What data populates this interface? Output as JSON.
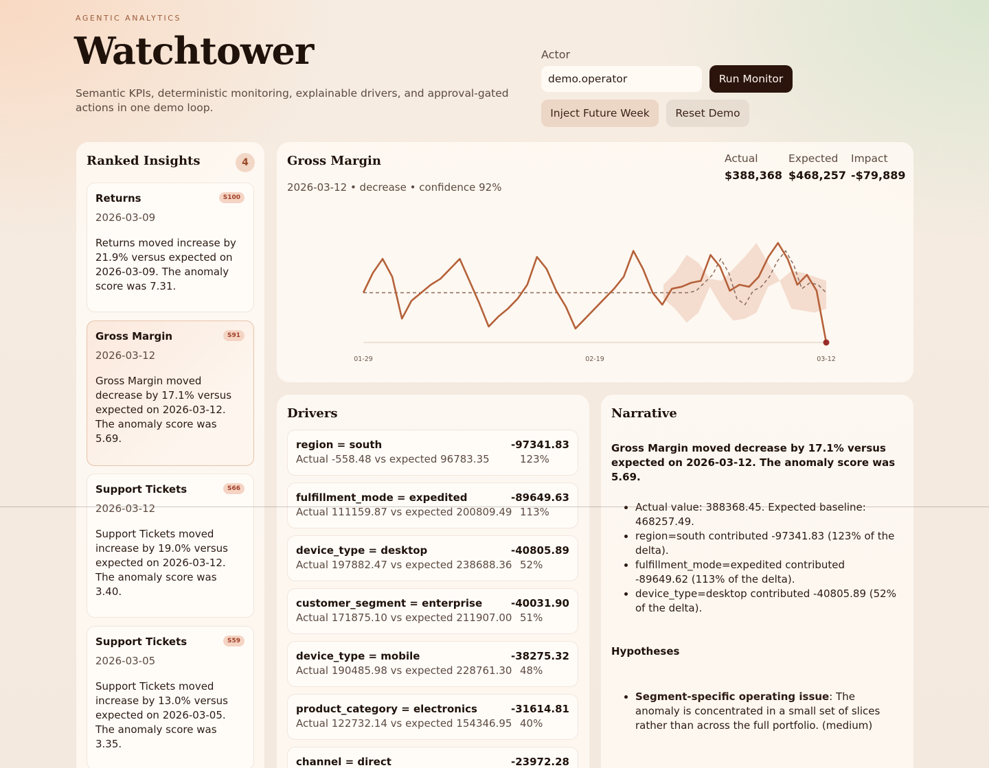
{
  "header": {
    "eyebrow": "AGENTIC ANALYTICS",
    "title": "Watchtower",
    "subtitle": "Semantic KPIs, deterministic monitoring, explainable drivers, and approval-gated actions in one demo loop."
  },
  "controls": {
    "actor_label": "Actor",
    "actor_value": "demo.operator",
    "run_label": "Run Monitor",
    "inject_label": "Inject Future Week",
    "reset_label": "Reset Demo"
  },
  "insights": {
    "title": "Ranked Insights",
    "count": "4",
    "items": [
      {
        "metric": "Returns",
        "score": "S100",
        "date": "2026-03-09",
        "text": "Returns moved increase by 21.9% versus expected on 2026-03-09. The anomaly score was 7.31."
      },
      {
        "metric": "Gross Margin",
        "score": "S91",
        "date": "2026-03-12",
        "text": "Gross Margin moved decrease by 17.1% versus expected on 2026-03-12. The anomaly score was 5.69."
      },
      {
        "metric": "Support Tickets",
        "score": "S66",
        "date": "2026-03-12",
        "text": "Support Tickets moved increase by 19.0% versus expected on 2026-03-12. The anomaly score was 3.40."
      },
      {
        "metric": "Support Tickets",
        "score": "S59",
        "date": "2026-03-05",
        "text": "Support Tickets moved increase by 13.0% versus expected on 2026-03-05. The anomaly score was 3.35."
      }
    ]
  },
  "detail": {
    "title": "Gross Margin",
    "subtitle": "2026-03-12 • decrease • confidence 92%",
    "actual_label": "Actual",
    "actual_value": "$388,368",
    "expected_label": "Expected",
    "expected_value": "$468,257",
    "impact_label": "Impact",
    "impact_value": "-$79,889"
  },
  "chart_data": {
    "type": "line",
    "x_tick_labels": [
      "01-29",
      "02-19",
      "03-12"
    ],
    "series": [
      {
        "values": [
          0.5,
          0.7,
          0.84,
          0.66,
          0.24,
          0.42,
          0.5,
          0.58,
          0.64,
          0.74,
          0.84,
          0.62,
          0.4,
          0.16,
          0.26,
          0.34,
          0.44,
          0.58,
          0.86,
          0.74,
          0.52,
          0.36,
          0.14,
          0.24,
          0.34,
          0.44,
          0.54,
          0.66,
          0.92,
          0.74,
          0.5,
          0.38,
          0.54,
          0.56,
          0.6,
          0.62,
          0.88,
          0.76,
          0.52,
          0.58,
          0.56,
          0.66,
          0.86,
          1.0,
          0.84,
          0.58,
          0.68,
          0.52,
          0.0
        ]
      },
      {
        "values": [
          0.5,
          0.5,
          0.5,
          0.5,
          0.5,
          0.5,
          0.5,
          0.5,
          0.5,
          0.5,
          0.5,
          0.5,
          0.5,
          0.5,
          0.5,
          0.5,
          0.5,
          0.5,
          0.5,
          0.5,
          0.5,
          0.5,
          0.5,
          0.5,
          0.5,
          0.5,
          0.5,
          0.5,
          0.5,
          0.5,
          0.5,
          0.5,
          0.5,
          0.5,
          0.5,
          0.5,
          0.5,
          0.5,
          0.5,
          0.5,
          0.5,
          0.52,
          0.6,
          0.68,
          0.84,
          0.7,
          0.44,
          0.38,
          0.52,
          0.56,
          0.66,
          0.82,
          0.92,
          0.78,
          0.54,
          0.6,
          0.58,
          0.5
        ]
      }
    ],
    "band_lower": [
      0.44,
      0.34,
      0.2,
      0.3,
      0.56,
      0.36,
      0.22,
      0.24,
      0.3,
      0.56,
      0.62,
      0.34,
      0.32,
      0.3,
      0.34
    ],
    "band_upper": [
      0.58,
      0.7,
      0.88,
      0.8,
      0.64,
      0.62,
      0.74,
      0.86,
      1.0,
      0.8,
      0.62,
      0.72,
      0.7,
      0.66,
      0.62
    ],
    "colors": {
      "actual": "#b5613a",
      "expected": "#8a6a5a",
      "band": "#f1d5c6",
      "last_point": "#9b2d28"
    }
  },
  "drivers": {
    "title": "Drivers",
    "items": [
      {
        "name": "region = south",
        "detail": "Actual -558.48 vs expected 96783.35",
        "value": "-97341.83",
        "pct": "123%"
      },
      {
        "name": "fulfillment_mode = expedited",
        "detail": "Actual 111159.87 vs expected 200809.49",
        "value": "-89649.63",
        "pct": "113%"
      },
      {
        "name": "device_type = desktop",
        "detail": "Actual 197882.47 vs expected 238688.36",
        "value": "-40805.89",
        "pct": "52%"
      },
      {
        "name": "customer_segment = enterprise",
        "detail": "Actual 171875.10 vs expected 211907.00",
        "value": "-40031.90",
        "pct": "51%"
      },
      {
        "name": "device_type = mobile",
        "detail": "Actual 190485.98 vs expected 228761.30",
        "value": "-38275.32",
        "pct": "48%"
      },
      {
        "name": "product_category = electronics",
        "detail": "Actual 122732.14 vs expected 154346.95",
        "value": "-31614.81",
        "pct": "40%"
      },
      {
        "name": "channel = direct",
        "detail": "",
        "value": "-23972.28",
        "pct": ""
      }
    ]
  },
  "narrative": {
    "title": "Narrative",
    "lead": "Gross Margin moved decrease by 17.1% versus expected on 2026-03-12. The anomaly score was 5.69.",
    "bullets": [
      "Actual value: 388368.45. Expected baseline: 468257.49.",
      "region=south contributed -97341.83 (123% of the delta).",
      "fulfillment_mode=expedited contributed -89649.62 (113% of the delta).",
      "device_type=desktop contributed -40805.89 (52% of the delta)."
    ],
    "hypotheses_title": "Hypotheses",
    "hypotheses": [
      {
        "label": "Segment-specific operating issue",
        "text": ": The anomaly is concentrated in a small set of slices rather than across the full portfolio. (medium)"
      }
    ]
  }
}
